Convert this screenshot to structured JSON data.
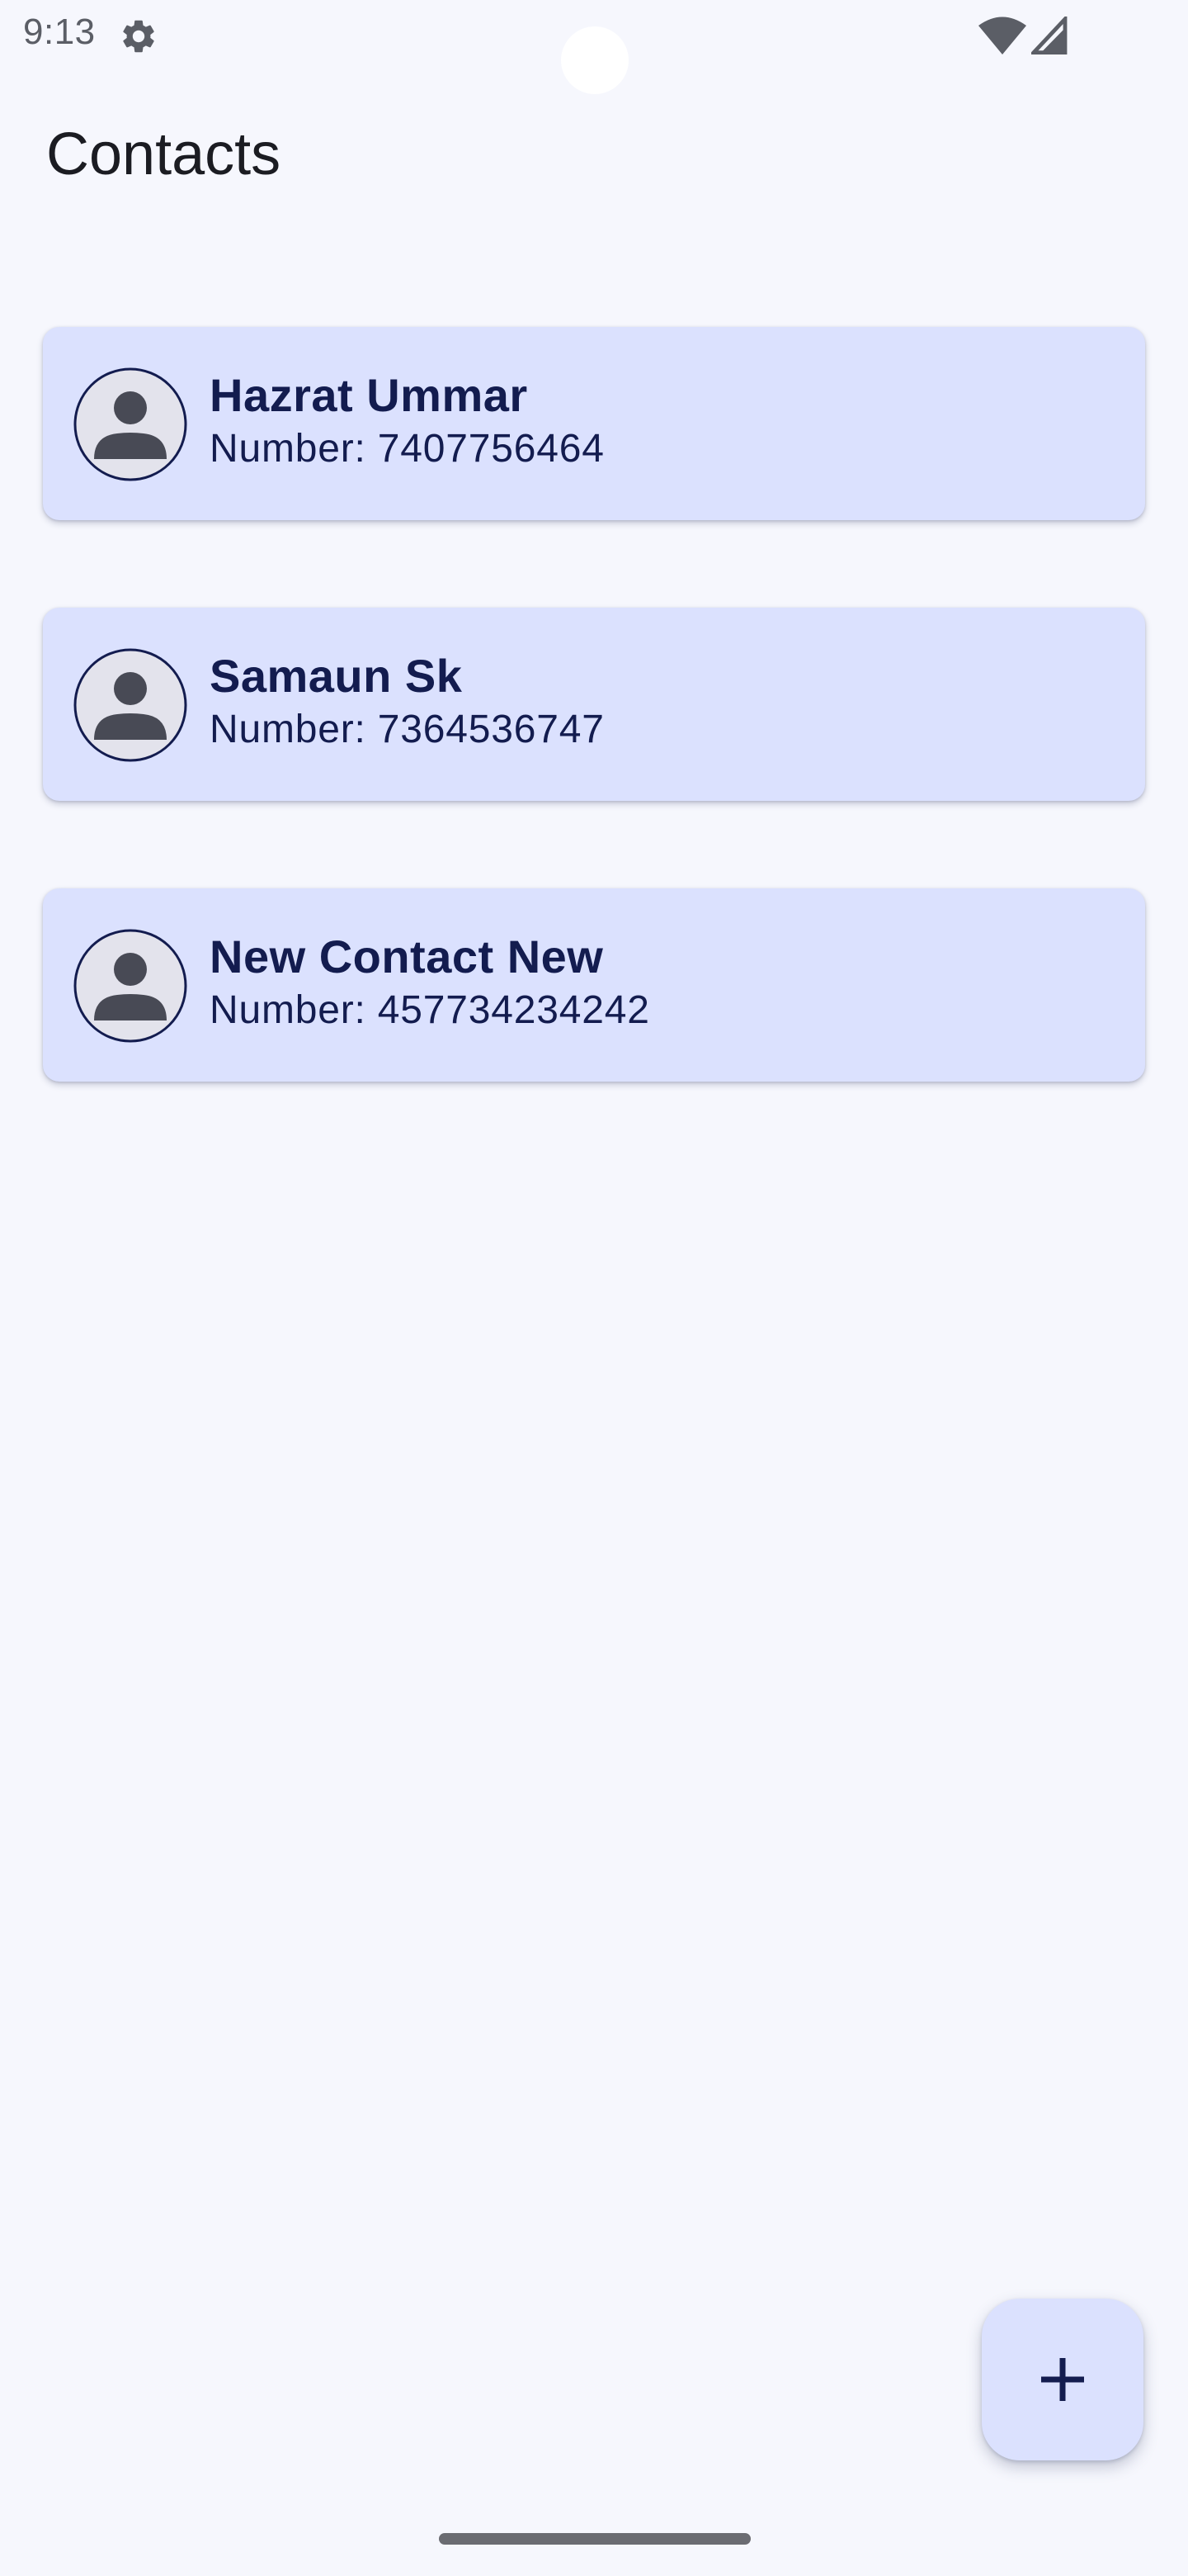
{
  "status_bar": {
    "time": "9:13",
    "icons": [
      "gear-icon",
      "wifi-icon",
      "cell-signal-icon"
    ]
  },
  "app": {
    "title": "Contacts"
  },
  "contacts": [
    {
      "name": "Hazrat Ummar",
      "number": "Number: 7407756464",
      "icon": "person-avatar-icon"
    },
    {
      "name": "Samaun Sk",
      "number": "Number: 7364536747",
      "icon": "person-avatar-icon"
    },
    {
      "name": "New Contact New",
      "number": "Number: 457734234242",
      "icon": "person-avatar-icon"
    }
  ],
  "fab": {
    "icon": "plus-icon"
  },
  "colors": {
    "background": "#f6f7fd",
    "card": "#dbe1fe",
    "card_text": "#131c4f",
    "avatar_fill": "#484a55",
    "title_text": "#1b1c22"
  }
}
